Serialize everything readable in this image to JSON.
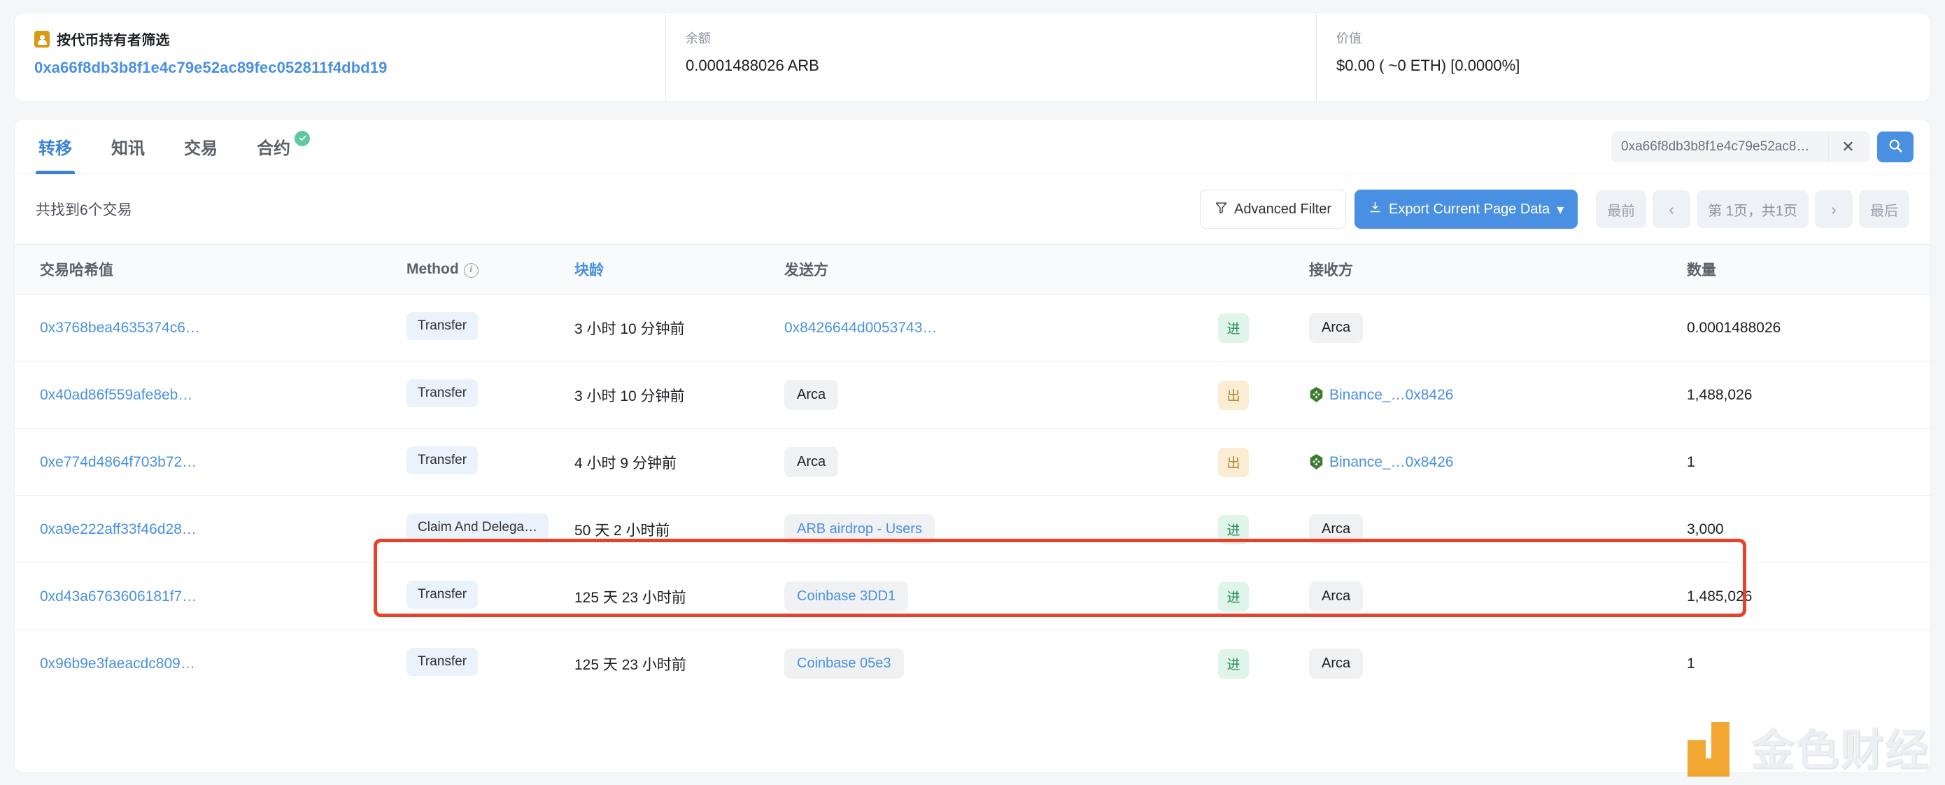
{
  "summary": {
    "holder_filter_label": "按代币持有者筛选",
    "holder_address": "0xa66f8db3b8f1e4c79e52ac89fec052811f4dbd19",
    "balance_label": "余额",
    "balance_value": "0.0001488026 ARB",
    "value_label": "价值",
    "value_value": "$0.00 ( ~0 ETH) [0.0000%]"
  },
  "tabs": [
    {
      "label": "转移",
      "active": true
    },
    {
      "label": "知讯",
      "active": false
    },
    {
      "label": "交易",
      "active": false
    },
    {
      "label": "合约",
      "active": false,
      "verified": true
    }
  ],
  "search": {
    "value": "0xa66f8db3b8f1e4c79e52ac8…",
    "placeholder": "0xa66f8db3b8f1e4c79e52ac8…",
    "clear_label": "✕"
  },
  "toolbar": {
    "found_text": "共找到6个交易",
    "advanced_filter_label": "Advanced Filter",
    "export_label": "Export Current Page Data",
    "export_caret": "▾",
    "pager": {
      "first": "最前",
      "prev": "‹",
      "info": "第 1页，共1页",
      "next": "›",
      "last": "最后"
    }
  },
  "table": {
    "columns": [
      {
        "label": "交易哈希值",
        "sortable": false,
        "info": false
      },
      {
        "label": "Method",
        "sortable": false,
        "info": true
      },
      {
        "label": "块龄",
        "sortable": true,
        "info": false
      },
      {
        "label": "发送方",
        "sortable": false,
        "info": false
      },
      {
        "label": "",
        "sortable": false,
        "info": false
      },
      {
        "label": "接收方",
        "sortable": false,
        "info": false
      },
      {
        "label": "数量",
        "sortable": false,
        "info": false
      }
    ],
    "rows": [
      {
        "hash": "0x3768bea4635374c6…",
        "method": "Transfer",
        "age": "3 小时 10 分钟前",
        "from": "0x8426644d0053743…",
        "from_type": "link",
        "direction": "进",
        "direction_type": "in",
        "to": "Arca",
        "to_type": "tag",
        "to_icon": false,
        "amount": "0.0001488026",
        "highlighted": false
      },
      {
        "hash": "0x40ad86f559afe8eb…",
        "method": "Transfer",
        "age": "3 小时 10 分钟前",
        "from": "Arca",
        "from_type": "tag",
        "direction": "出",
        "direction_type": "out",
        "to": "Binance_…0x8426",
        "to_type": "link",
        "to_icon": true,
        "amount": "1,488,026",
        "highlighted": true
      },
      {
        "hash": "0xe774d4864f703b72…",
        "method": "Transfer",
        "age": "4 小时 9 分钟前",
        "from": "Arca",
        "from_type": "tag",
        "direction": "出",
        "direction_type": "out",
        "to": "Binance_…0x8426",
        "to_type": "link",
        "to_icon": true,
        "amount": "1",
        "highlighted": true
      },
      {
        "hash": "0xa9e222aff33f46d28…",
        "method": "Claim And Delega…",
        "age": "50 天 2 小时前",
        "from": "ARB airdrop - Users",
        "from_type": "tag-link",
        "direction": "进",
        "direction_type": "in",
        "to": "Arca",
        "to_type": "tag",
        "to_icon": false,
        "amount": "3,000",
        "highlighted": false
      },
      {
        "hash": "0xd43a6763606181f7…",
        "method": "Transfer",
        "age": "125 天 23 小时前",
        "from": "Coinbase 3DD1",
        "from_type": "tag-link",
        "direction": "进",
        "direction_type": "in",
        "to": "Arca",
        "to_type": "tag",
        "to_icon": false,
        "amount": "1,485,026",
        "highlighted": false
      },
      {
        "hash": "0x96b9e3faeacdc809…",
        "method": "Transfer",
        "age": "125 天 23 小时前",
        "from": "Coinbase 05e3",
        "from_type": "tag-link",
        "direction": "进",
        "direction_type": "in",
        "to": "Arca",
        "to_type": "tag",
        "to_icon": false,
        "amount": "1",
        "highlighted": false
      }
    ]
  },
  "watermark": {
    "text": "金色财经"
  },
  "colors": {
    "accent": "#4a90e2",
    "highlight_box": "#e8412a",
    "in_badge_bg": "#dff5e9",
    "out_badge_bg": "#fbedd4",
    "verified": "#5ec9a0",
    "logo_orange": "#f0a020"
  }
}
